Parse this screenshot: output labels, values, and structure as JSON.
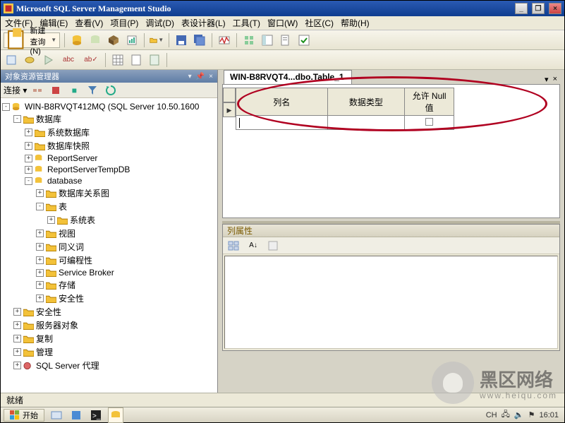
{
  "title": "Microsoft SQL Server Management Studio",
  "menu": {
    "file": "文件(F)",
    "edit": "编辑(E)",
    "view": "查看(V)",
    "project": "项目(P)",
    "debug": "调试(D)",
    "tabledesigner": "表设计器(L)",
    "tools": "工具(T)",
    "window": "窗口(W)",
    "community": "社区(C)",
    "help": "帮助(H)"
  },
  "toolbar": {
    "new_query": "新建查询(N)"
  },
  "object_explorer": {
    "title": "对象资源管理器",
    "connect_label": "连接 ▾",
    "root": "WIN-B8RVQT412MQ (SQL Server 10.50.1600",
    "databases": "数据库",
    "sys_databases": "系统数据库",
    "db_snapshots": "数据库快照",
    "report_server": "ReportServer",
    "report_server_temp": "ReportServerTempDB",
    "user_db": "database",
    "db_diagrams": "数据库关系图",
    "tables": "表",
    "sys_tables": "系统表",
    "views": "视图",
    "synonyms": "同义词",
    "programmability": "可编程性",
    "service_broker": "Service Broker",
    "storage": "存储",
    "security_inner": "安全性",
    "security": "安全性",
    "server_objects": "服务器对象",
    "replication": "复制",
    "management": "管理",
    "agent": "SQL Server 代理"
  },
  "designer": {
    "tab_title": "WIN-B8RVQT4...dbo.Table_1",
    "col_name": "列名",
    "col_type": "数据类型",
    "col_null": "允许 Null 值"
  },
  "properties": {
    "title": "列属性"
  },
  "statusbar": {
    "ready": "就绪"
  },
  "taskbar": {
    "start": "开始",
    "ime": "CH",
    "time": "16:01"
  },
  "watermark": {
    "brand": "黑区网络",
    "domain": "www.heiqu.com"
  }
}
